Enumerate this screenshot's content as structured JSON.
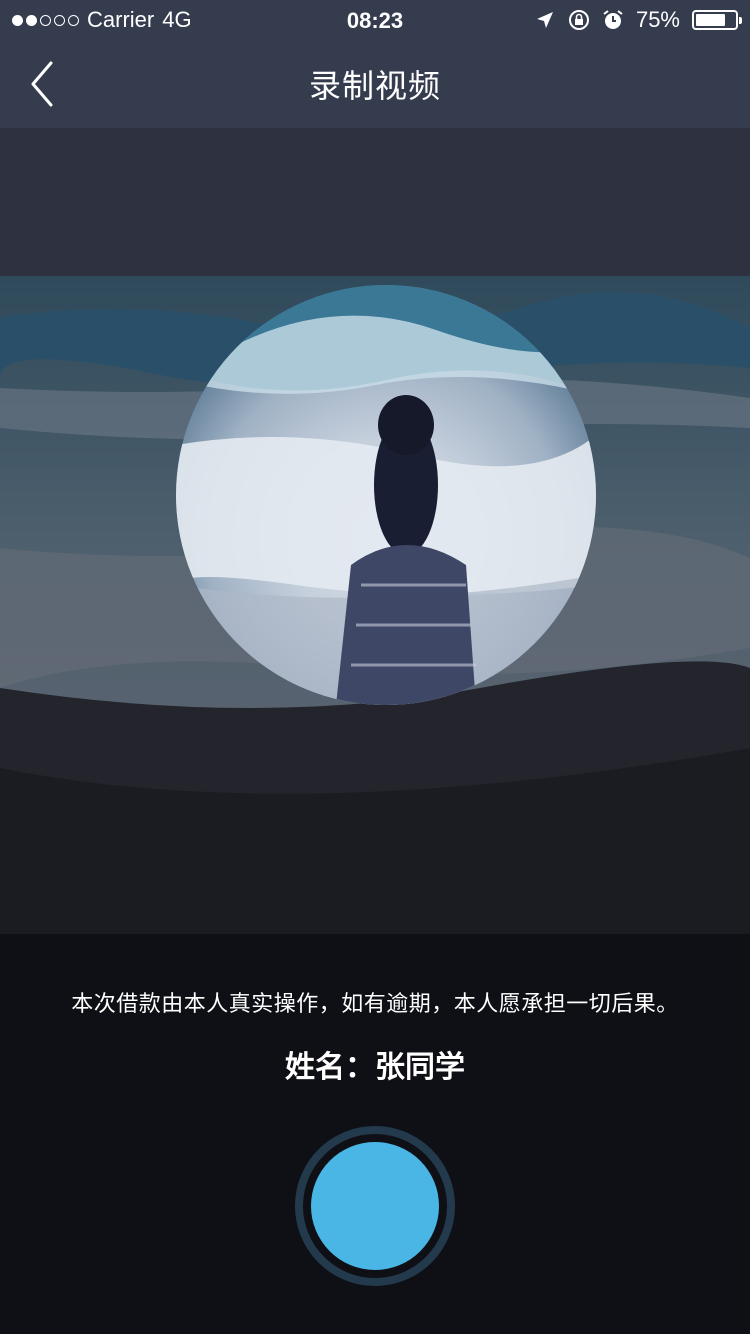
{
  "status_bar": {
    "carrier": "Carrier",
    "network": "4G",
    "time": "08:23",
    "battery": "75%",
    "battery_level": 0.75,
    "signal_bars_filled": 2,
    "signal_bars_total": 5,
    "icons": [
      "location-icon",
      "rotation-lock-icon",
      "alarm-icon",
      "battery-icon"
    ]
  },
  "navbar": {
    "title": "录制视频",
    "back_icon": "chevron-left-icon"
  },
  "panel": {
    "statement": "本次借款由本人真实操作，如有逾期，本人愿承担一切后果。",
    "name_label": "姓名：",
    "name_value": "张同学"
  },
  "record": {
    "accent_color": "#4ab6e6",
    "ring_color": "#233a4c"
  }
}
